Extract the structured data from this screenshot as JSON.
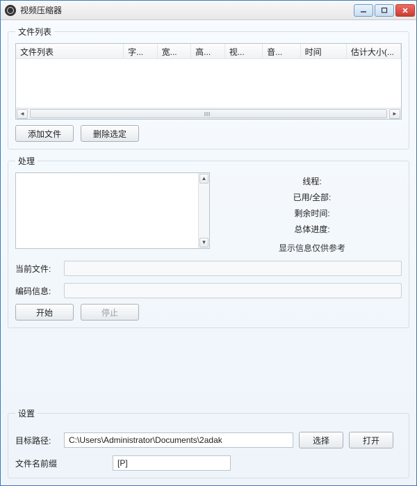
{
  "titlebar": {
    "title": "视频压缩器"
  },
  "fileList": {
    "legend": "文件列表",
    "columns": [
      "文件列表",
      "字...",
      "宽...",
      "高...",
      "视...",
      "音...",
      "时间",
      "估计大小(..."
    ],
    "rows": [],
    "buttons": {
      "add": "添加文件",
      "remove": "删除选定"
    }
  },
  "processing": {
    "legend": "处理",
    "stats": {
      "threads_label": "线程:",
      "used_total_label": "已用/全部:",
      "remaining_label": "剩余时间:",
      "overall_label": "总体进度:"
    },
    "note": "显示信息仅供参考",
    "currentFile": {
      "label": "当前文件:"
    },
    "encodeInfo": {
      "label": "编码信息:"
    },
    "buttons": {
      "start": "开始",
      "stop": "停止"
    }
  },
  "settings": {
    "legend": "设置",
    "targetPath": {
      "label": "目标路径:",
      "value": "C:\\Users\\Administrator\\Documents\\2adak"
    },
    "buttons": {
      "choose": "选择",
      "open": "打开"
    },
    "prefix": {
      "label": "文件名前缀",
      "value": "[P]"
    }
  }
}
